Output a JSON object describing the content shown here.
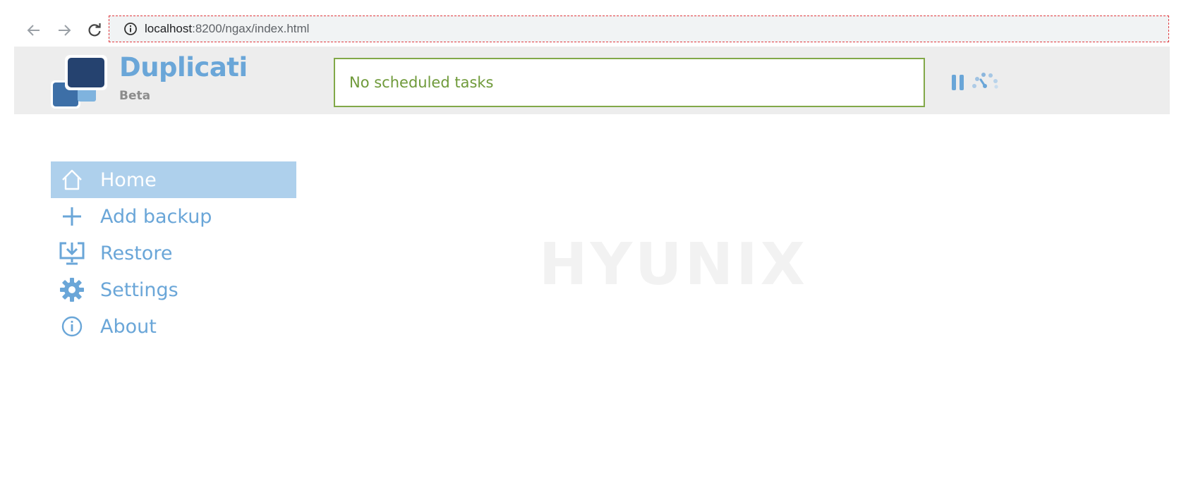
{
  "browser": {
    "url_host": "localhost",
    "url_rest": ":8200/ngax/index.html"
  },
  "header": {
    "brand_name": "Duplicati",
    "brand_sub": "Beta",
    "status_text": "No scheduled tasks"
  },
  "sidebar": {
    "items": [
      {
        "label": "Home",
        "icon": "home-icon",
        "active": true
      },
      {
        "label": "Add backup",
        "icon": "plus-icon",
        "active": false
      },
      {
        "label": "Restore",
        "icon": "restore-icon",
        "active": false
      },
      {
        "label": "Settings",
        "icon": "gear-icon",
        "active": false
      },
      {
        "label": "About",
        "icon": "info-icon",
        "active": false
      }
    ]
  },
  "watermark": "HYUNIX",
  "colors": {
    "accent": "#6aa6d8",
    "active_bg": "#aed0ec",
    "status_border": "#82a848",
    "status_text": "#6f9a3a",
    "header_bg": "#ededed"
  }
}
